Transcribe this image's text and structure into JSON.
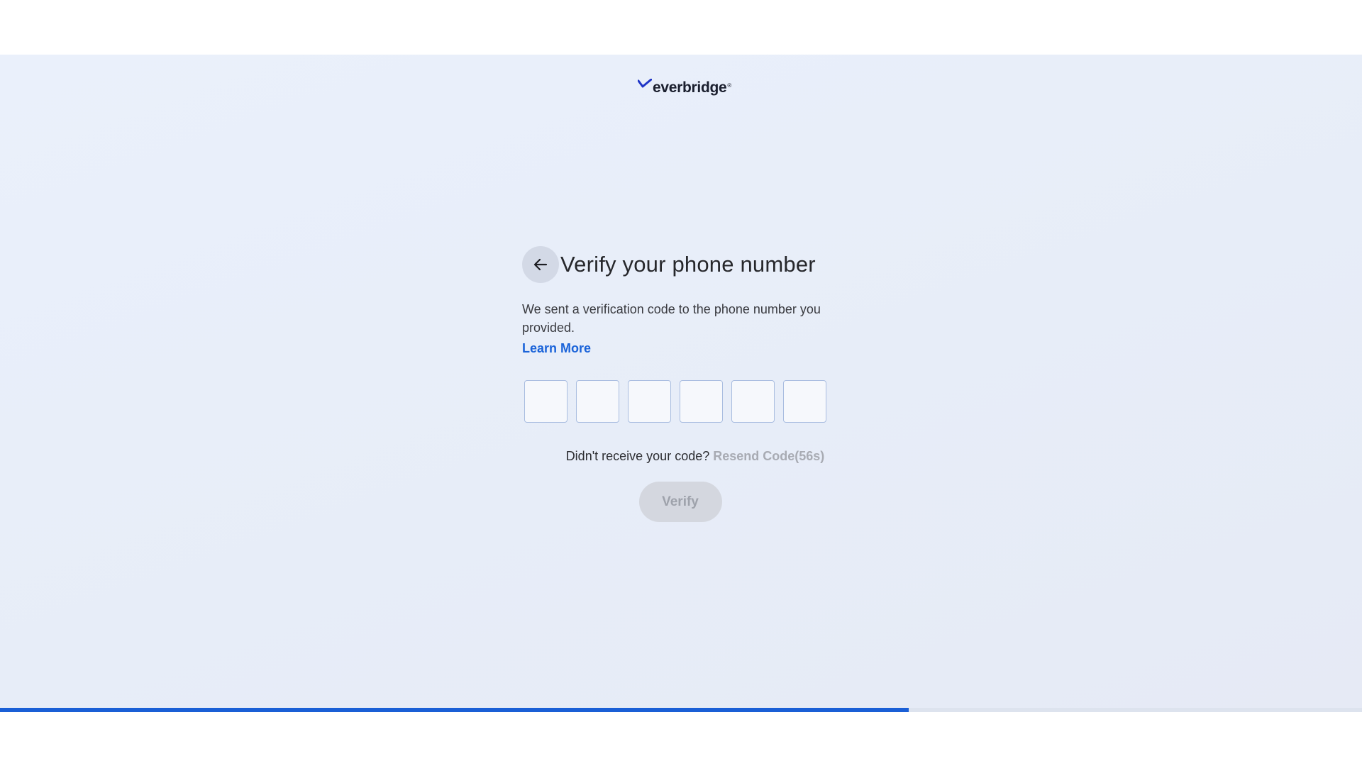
{
  "header": {
    "logo_text": "everbridge",
    "logo_tm": "®"
  },
  "main": {
    "back_icon": "arrow-left-icon",
    "title": "Verify your phone number",
    "description": "We sent a verification code to the phone number you provided.",
    "learn_more_label": "Learn More",
    "code_inputs": [
      "",
      "",
      "",
      "",
      "",
      ""
    ],
    "resend_prompt": "Didn't receive your code?",
    "resend_label": "Resend Code(56s)",
    "verify_label": "Verify"
  },
  "progress": {
    "value": 0.667
  },
  "colors": {
    "accent": "#1a63d9",
    "background": "#e8eef9",
    "disabled_button": "#d4d7df",
    "disabled_text": "#a8abb3",
    "progress_fill": "#1a5fd6"
  }
}
